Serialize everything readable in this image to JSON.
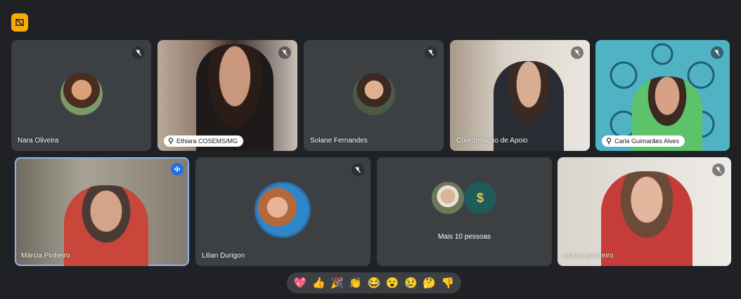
{
  "participants": [
    {
      "name": "Nara Oliveira"
    },
    {
      "name": "Ethiara COSEMS/MG"
    },
    {
      "name": "Solane Fernandes"
    },
    {
      "name": "Coordenação de Apoio"
    },
    {
      "name": "Carla Guimarães Alves"
    },
    {
      "name": "Márcia Pinheiro"
    },
    {
      "name": "Lilian Durigon"
    },
    {
      "name": "ariane guerreiro"
    }
  ],
  "more": {
    "label": "Mais 10 pessoas"
  },
  "reactions": [
    "💖",
    "👍",
    "🎉",
    "👏",
    "😂",
    "😮",
    "😢",
    "🤔",
    "👎"
  ],
  "colors": {
    "background": "#202124",
    "tile": "#3c4043",
    "badge": "#f9ab00",
    "active": "#8ab4f8"
  },
  "icons": [
    "layout-badge-icon",
    "mic-off-icon",
    "pin-icon",
    "audio-level-icon"
  ]
}
